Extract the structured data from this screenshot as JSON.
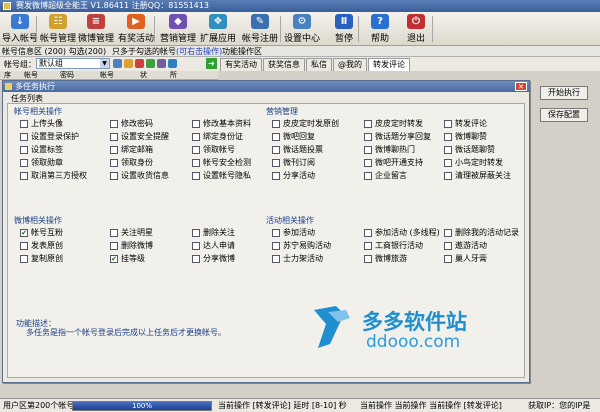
{
  "window": {
    "title": "赛发微博超级全能王 V1.86411 注册QQ：81551413"
  },
  "toolbar": {
    "buttons": [
      {
        "label": "导入帐号",
        "icon": "import-icon",
        "color": "#3a7ad0",
        "glyph": "↓"
      },
      {
        "label": "帐号管理",
        "icon": "account-icon",
        "color": "#d0a030",
        "glyph": "☷"
      },
      {
        "label": "微博管理",
        "icon": "weibo-icon",
        "color": "#c04040",
        "glyph": "≡"
      },
      {
        "label": "有奖活动",
        "icon": "prize-icon",
        "color": "#e06020",
        "glyph": "▶"
      },
      {
        "label": "营销管理",
        "icon": "marketing-icon",
        "color": "#7050b0",
        "glyph": "◆"
      },
      {
        "label": "扩展应用",
        "icon": "extend-icon",
        "color": "#3090c0",
        "glyph": "❖"
      },
      {
        "label": "帐号注册",
        "icon": "register-icon",
        "color": "#3a70b0",
        "glyph": "✎"
      },
      {
        "label": "设置中心",
        "icon": "settings-icon",
        "color": "#4a80c0",
        "glyph": "⚙"
      },
      {
        "label": "暂停",
        "icon": "pause-icon",
        "color": "#2a60c0",
        "glyph": "Ⅱ"
      },
      {
        "label": "帮助",
        "icon": "help-icon",
        "color": "#2a70d0",
        "glyph": "?"
      },
      {
        "label": "退出",
        "icon": "exit-icon",
        "color": "#c03030",
        "glyph": "⏻"
      }
    ]
  },
  "acctbar": {
    "info": "帐号信息区 (200)  勾选(200)",
    "hint": "只多于勾选的帐号",
    "link": "(可右击操作)",
    "fn": "功能操作区"
  },
  "group": {
    "label": "帐号组：",
    "selected": "默认组"
  },
  "tabs": [
    "有奖活动",
    "获奖信息",
    "私信",
    "@我的",
    "转发评论"
  ],
  "columns": [
    "序",
    "帐号",
    "密码",
    "帐号",
    "状",
    "所"
  ],
  "right_buttons": {
    "start": "开始执行",
    "save": "保存配置"
  },
  "dialog": {
    "title": "多任务执行",
    "tasklist": "任务列表",
    "sections": {
      "account": {
        "title": "帐号相关操作",
        "items": [
          {
            "label": "上传头像",
            "checked": false
          },
          {
            "label": "修改密码",
            "checked": false
          },
          {
            "label": "修改基本资料",
            "checked": false
          },
          {
            "label": "设置登录保护",
            "checked": false
          },
          {
            "label": "设置安全提醒",
            "checked": false
          },
          {
            "label": "绑定身份证",
            "checked": false
          },
          {
            "label": "设置标签",
            "checked": false
          },
          {
            "label": "绑定邮箱",
            "checked": false
          },
          {
            "label": "领取帐号",
            "checked": false
          },
          {
            "label": "领取勋章",
            "checked": false
          },
          {
            "label": "领取身份",
            "checked": false
          },
          {
            "label": "帐号安全检测",
            "checked": false
          },
          {
            "label": "取消第三方授权",
            "checked": false
          },
          {
            "label": "设置收货信息",
            "checked": false
          },
          {
            "label": "设置帐号隐私",
            "checked": false
          }
        ]
      },
      "marketing": {
        "title": "营销管理",
        "items": [
          {
            "label": "皮皮定时发原创",
            "checked": false
          },
          {
            "label": "皮皮定时转发",
            "checked": false
          },
          {
            "label": "转发评论",
            "checked": false
          },
          {
            "label": "微吧回复",
            "checked": false
          },
          {
            "label": "微话题分享回复",
            "checked": false
          },
          {
            "label": "微博聊赞",
            "checked": false
          },
          {
            "label": "微话题投票",
            "checked": false
          },
          {
            "label": "微博聊热门",
            "checked": false
          },
          {
            "label": "微话题聊赞",
            "checked": false
          },
          {
            "label": "微刊订阅",
            "checked": false
          },
          {
            "label": "微吧开通支持",
            "checked": false
          },
          {
            "label": "小鸟定时转发",
            "checked": false
          },
          {
            "label": "分享活动",
            "checked": false
          },
          {
            "label": "企业留言",
            "checked": false
          },
          {
            "label": "清理被屏蔽关注",
            "checked": false
          }
        ]
      },
      "weibo": {
        "title": "微博相关操作",
        "items": [
          {
            "label": "帐号互粉",
            "checked": true
          },
          {
            "label": "关注明星",
            "checked": false
          },
          {
            "label": "删除关注",
            "checked": false
          },
          {
            "label": "发表原创",
            "checked": false
          },
          {
            "label": "删除微博",
            "checked": false
          },
          {
            "label": "达人申请",
            "checked": false
          },
          {
            "label": "复制原创",
            "checked": false
          },
          {
            "label": "挂等级",
            "checked": true
          },
          {
            "label": "分享微博",
            "checked": false
          }
        ]
      },
      "activity": {
        "title": "活动相关操作",
        "items": [
          {
            "label": "参加活动",
            "checked": false
          },
          {
            "label": "参加活动 (多线程)",
            "checked": false
          },
          {
            "label": "删除我的活动记录",
            "checked": false
          },
          {
            "label": "苏宁易购活动",
            "checked": false
          },
          {
            "label": "工商银行活动",
            "checked": false
          },
          {
            "label": "遨游活动",
            "checked": false
          },
          {
            "label": "士力架活动",
            "checked": false
          },
          {
            "label": "微博旅游",
            "checked": false
          },
          {
            "label": "巢人牙膏",
            "checked": false
          }
        ]
      }
    },
    "desc_title": "功能描述：",
    "desc": "多任务是指一个帐号登录后完成以上任务后才更换帐号。"
  },
  "watermark": {
    "text": "多多软件站",
    "url": "ddooo.com"
  },
  "status": {
    "user": "用户区第200个帐号",
    "progress_pct": 100,
    "progress_label": "100%",
    "op1": "当前操作 [转发评论] 延时 [8-10] 秒",
    "op2": "当前操作 当前操作 当前操作 [转发评论]",
    "ip": "获取IP：您的IP是"
  }
}
